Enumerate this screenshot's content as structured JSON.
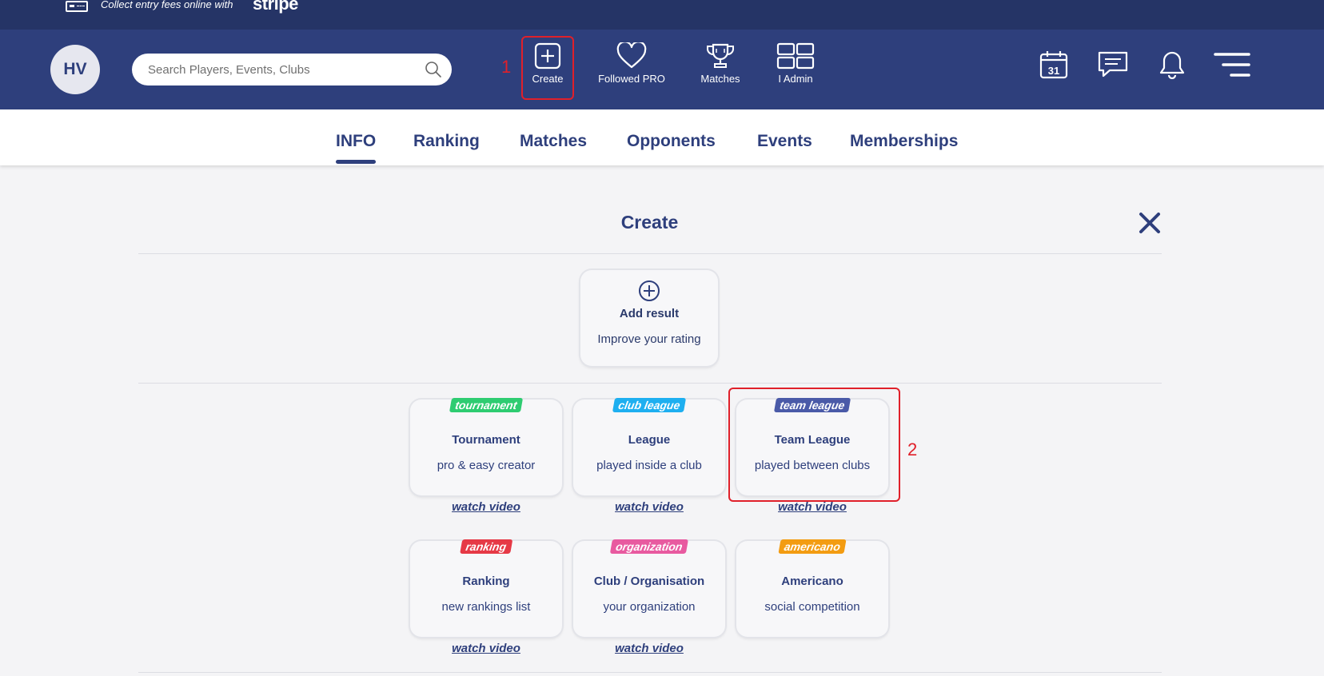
{
  "promo": {
    "text": "Collect entry fees online with",
    "brand": "stripe"
  },
  "header": {
    "avatar_initials": "HV",
    "search_placeholder": "Search Players, Events, Clubs",
    "nav": [
      {
        "label": "Create",
        "icon": "plus-square-icon"
      },
      {
        "label": "Followed PRO",
        "icon": "heart-icon"
      },
      {
        "label": "Matches",
        "icon": "trophy-icon"
      },
      {
        "label": "I Admin",
        "icon": "grid-icon"
      }
    ],
    "calendar_day": "31",
    "step1": "1",
    "step2": "2"
  },
  "tabs": [
    "INFO",
    "Ranking",
    "Matches",
    "Opponents",
    "Events",
    "Memberships"
  ],
  "active_tab": "INFO",
  "create": {
    "title": "Create",
    "add_result": {
      "name": "Add result",
      "desc": "Improve your rating"
    },
    "watch_label": "watch video",
    "tiles": [
      {
        "tag": "tournament",
        "tag_color": "#2ecc71",
        "name": "Tournament",
        "desc": "pro & easy creator",
        "video": true
      },
      {
        "tag": "club league",
        "tag_color": "#1eaff0",
        "name": "League",
        "desc": "played inside a club",
        "video": true
      },
      {
        "tag": "team league",
        "tag_color": "#4a5aa8",
        "name": "Team League",
        "desc": "played between clubs",
        "video": true
      },
      {
        "tag": "ranking",
        "tag_color": "#e63946",
        "name": "Ranking",
        "desc": "new rankings list",
        "video": true
      },
      {
        "tag": "organization",
        "tag_color": "#e85aa0",
        "name": "Club / Organisation",
        "desc": "your organization",
        "video": true
      },
      {
        "tag": "americano",
        "tag_color": "#f39c12",
        "name": "Americano",
        "desc": "social competition",
        "video": false
      }
    ]
  }
}
